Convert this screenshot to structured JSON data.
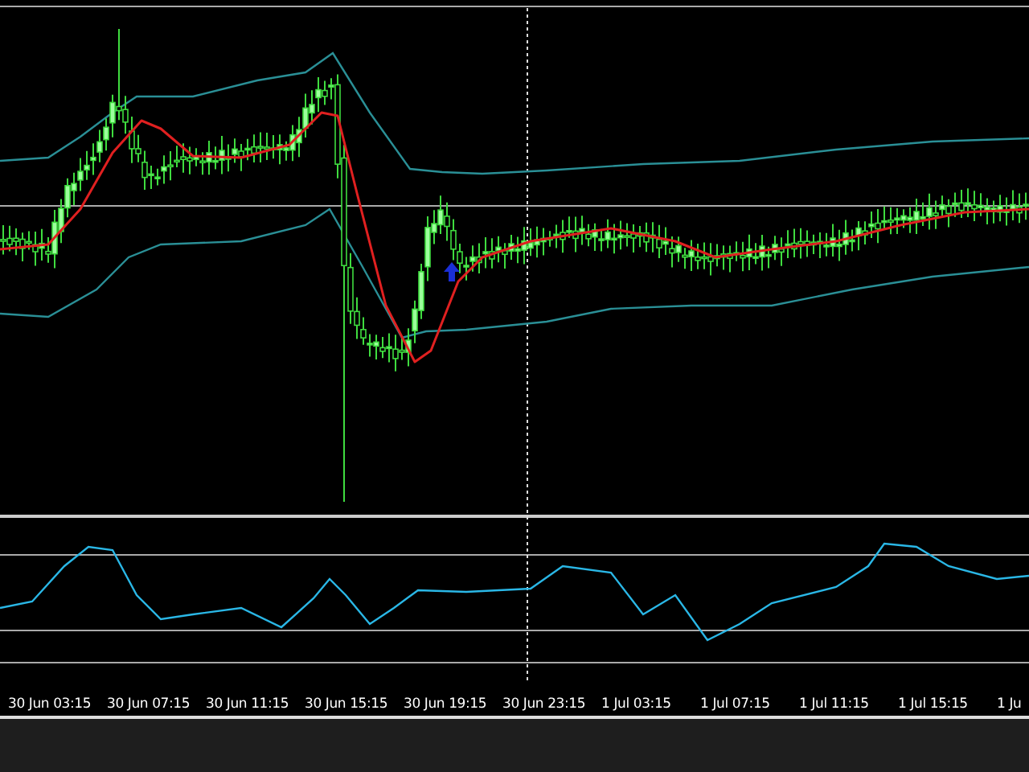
{
  "time_axis": {
    "labels": [
      "30 Jun 03:15",
      "30 Jun 07:15",
      "30 Jun 11:15",
      "30 Jun 15:15",
      "30 Jun 19:15",
      "30 Jun 23:15",
      "1 Jul 03:15",
      "1 Jul 07:15",
      "1 Jul 11:15",
      "1 Jul 15:15",
      "1 Ju"
    ]
  }
}
